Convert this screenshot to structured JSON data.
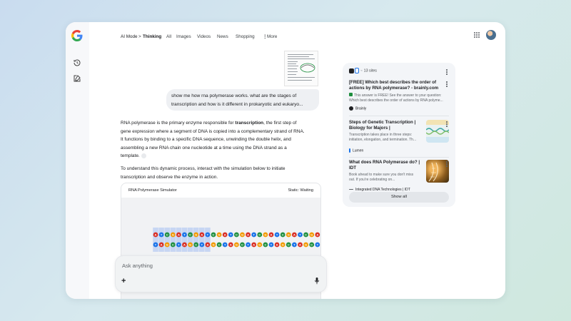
{
  "nav": {
    "mode": "AI Mode",
    "separator": ">",
    "thinking": "Thinking",
    "tabs": [
      "All",
      "Images",
      "Videos",
      "News",
      "Shopping"
    ],
    "more": "More",
    "more_icon": "vertical-dots-icon"
  },
  "rail": {
    "icons": [
      "history-icon",
      "new-chat-icon"
    ]
  },
  "header_right": {
    "apps_icon": "apps-grid-icon",
    "avatar": "user-avatar"
  },
  "conversation": {
    "user_query_line1": "show me how rna polymerase works. what are the stages of",
    "user_query_line2": "transcription and how is it different in prokaryotic and eukaryo...",
    "answer_p1_lines": [
      "RNA polymerase is the primary enzyme responsible for ",
      "transcription",
      ", the first step of",
      "gene expression where a segment of DNA is copied into a complementary strand of RNA.",
      "It functions by binding to a specific DNA sequence, unwinding the double helix, and",
      "assembling a new RNA chain one nucleotide at a time using the DNA strand as a",
      "template."
    ],
    "answer_p2_line1": "To understand this dynamic process, interact with the simulation below to initiate",
    "answer_p2_line2": "transcription and observe the enzyme in action."
  },
  "simulator": {
    "title": "RNA Polymerase Simulator",
    "status": "Static: Waiting",
    "top_strand": [
      "A",
      "T",
      "C",
      "G",
      "A",
      "T",
      "C",
      "G",
      "A",
      "T",
      "C",
      "G",
      "A",
      "T",
      "C",
      "G",
      "A",
      "T",
      "C",
      "G",
      "A",
      "T",
      "C",
      "G",
      "A",
      "T",
      "C",
      "G",
      "A",
      "T",
      "C",
      "G"
    ],
    "bottom_strand": [
      "T",
      "A",
      "G",
      "C",
      "T",
      "A",
      "G",
      "C",
      "T",
      "A",
      "G",
      "C",
      "T",
      "A",
      "G",
      "C",
      "T",
      "A",
      "G",
      "C",
      "T",
      "A",
      "G",
      "C",
      "T",
      "A",
      "G",
      "C",
      "T",
      "A",
      "G",
      "C"
    ],
    "highlighted_pairs": 10,
    "base_colors": {
      "A": "#d93025",
      "T": "#1a73e8",
      "C": "#1e8e3e",
      "G": "#f29900"
    }
  },
  "input": {
    "placeholder": "Ask anything",
    "add_icon": "plus-icon",
    "mic_icon": "microphone-icon"
  },
  "sources": {
    "count_label": "13 sites",
    "cards": [
      {
        "title_line1": "[FREE] Which best describes the order of",
        "title_line2": "actions by RNA polymerase? - brainly.com",
        "snippet_line1": "This answer is FREE! See the answer to your question:",
        "snippet_line2": "Which best describes the order of actions by RNA polyme...",
        "site": "Brainly"
      },
      {
        "title_line1": "Steps of Genetic Transcription |",
        "title_line2": "Biology for Majors |",
        "snippet_line1": "Transcription takes place in three steps:",
        "snippet_line2": "initiation, elongation, and termination. Th...",
        "site": "Lumen"
      },
      {
        "title_line1": "What does RNA Polymerase do? |",
        "title_line2": "IDT",
        "snippet_line1": "Book ahead to make sure you don't miss",
        "snippet_line2": "out. If you're celebrating on...",
        "site": "Integrated DNA Technologies | IDT"
      }
    ],
    "show_all": "Show all"
  }
}
